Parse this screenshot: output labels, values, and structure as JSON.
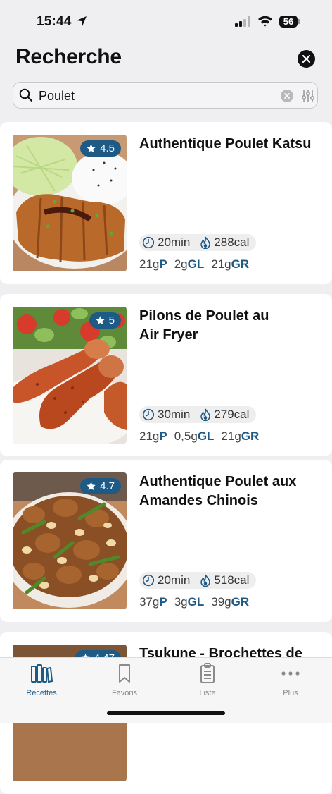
{
  "status": {
    "time": "15:44",
    "battery": "56"
  },
  "header": {
    "title": "Recherche"
  },
  "search": {
    "value": "Poulet",
    "placeholder": ""
  },
  "recipes": [
    {
      "title": "Authentique Poulet Katsu",
      "rating": "4.5",
      "time": "20min",
      "calories": "288cal",
      "protein_val": "21g",
      "protein_unit": "P",
      "lipid_val": "2g",
      "lipid_unit": "GL",
      "carb_val": "21g",
      "carb_unit": "GR"
    },
    {
      "title": "Pilons de Poulet au Air Fryer",
      "rating": "5",
      "time": "30min",
      "calories": "279cal",
      "protein_val": "21g",
      "protein_unit": "P",
      "lipid_val": "0,5g",
      "lipid_unit": "GL",
      "carb_val": "21g",
      "carb_unit": "GR"
    },
    {
      "title": "Authentique Poulet aux Amandes Chinois",
      "rating": "4.7",
      "time": "20min",
      "calories": "518cal",
      "protein_val": "37g",
      "protein_unit": "P",
      "lipid_val": "3g",
      "lipid_unit": "GL",
      "carb_val": "39g",
      "carb_unit": "GR"
    },
    {
      "title": "Tsukune - Brochettes de",
      "rating": "4.47"
    }
  ],
  "tabs": [
    {
      "label": "Recettes",
      "icon": "books-icon",
      "active": true
    },
    {
      "label": "Favoris",
      "icon": "bookmark-icon"
    },
    {
      "label": "Liste",
      "icon": "clipboard-icon"
    },
    {
      "label": "Plus",
      "icon": "more-icon"
    }
  ],
  "colors": {
    "accent": "#1e5a86",
    "background": "#efeff1",
    "card": "#ffffff"
  }
}
